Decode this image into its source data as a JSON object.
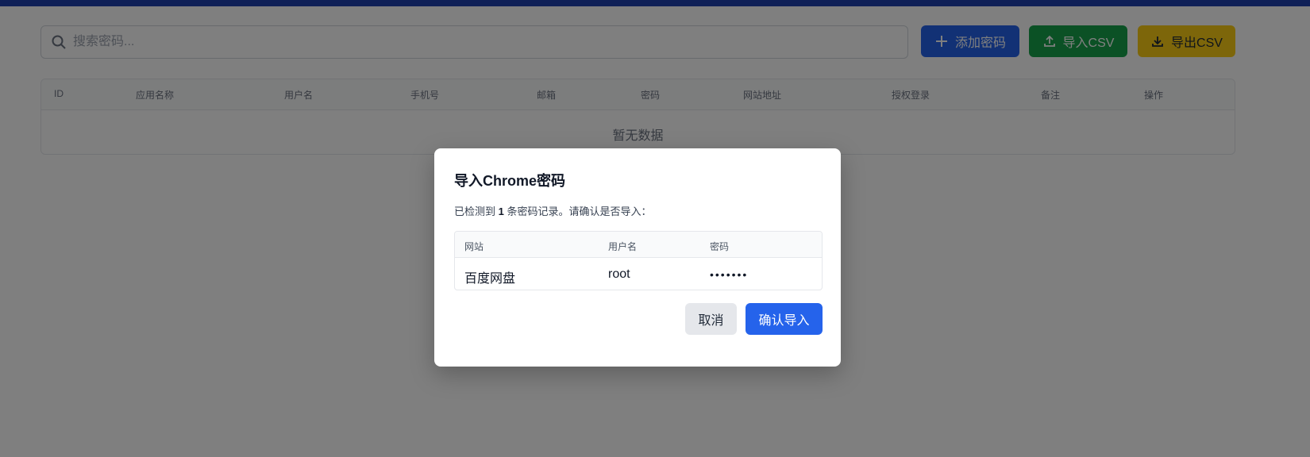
{
  "colors": {
    "accent": "#2563eb",
    "top_bar": "#1e40af",
    "import_button": "#16a34a",
    "export_button": "#facc15",
    "overlay": "rgba(0,0,0,0.5)"
  },
  "search": {
    "placeholder": "搜索密码...",
    "value": "",
    "icon": "search-icon"
  },
  "toolbar": {
    "add_label": "添加密码",
    "add_icon": "plus-icon",
    "import_label": "导入CSV",
    "import_icon": "upload-icon",
    "export_label": "导出CSV",
    "export_icon": "download-icon"
  },
  "table": {
    "columns": [
      "ID",
      "应用名称",
      "用户名",
      "手机号",
      "邮箱",
      "密码",
      "网站地址",
      "授权登录",
      "备注",
      "操作"
    ],
    "empty_text": "暂无数据"
  },
  "modal": {
    "title": "导入Chrome密码",
    "desc_prefix": "已检测到 ",
    "desc_count": "1",
    "desc_suffix": " 条密码记录。请确认是否导入：",
    "columns": [
      "网站",
      "用户名",
      "密码"
    ],
    "rows": [
      {
        "site": "百度网盘",
        "username": "root",
        "password": "•••••••"
      }
    ],
    "cancel_label": "取消",
    "confirm_label": "确认导入"
  }
}
